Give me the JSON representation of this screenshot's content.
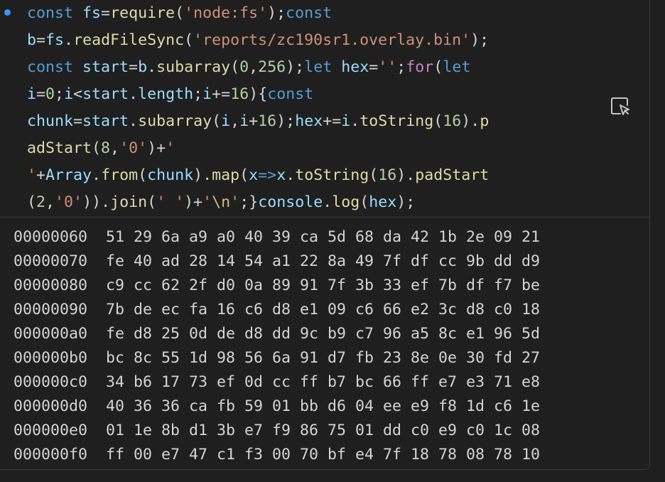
{
  "code": {
    "lines": [
      [
        {
          "t": "const",
          "c": "tk-keyword"
        },
        {
          "t": " ",
          "c": "tk-plain"
        },
        {
          "t": "fs",
          "c": "tk-var"
        },
        {
          "t": "=",
          "c": "tk-plain"
        },
        {
          "t": "require",
          "c": "tk-func"
        },
        {
          "t": "(",
          "c": "tk-plain"
        },
        {
          "t": "'node:fs'",
          "c": "tk-string"
        },
        {
          "t": ");",
          "c": "tk-plain"
        },
        {
          "t": "const",
          "c": "tk-keyword"
        }
      ],
      [
        {
          "t": "b",
          "c": "tk-var"
        },
        {
          "t": "=",
          "c": "tk-plain"
        },
        {
          "t": "fs",
          "c": "tk-var"
        },
        {
          "t": ".",
          "c": "tk-plain"
        },
        {
          "t": "readFileSync",
          "c": "tk-func"
        },
        {
          "t": "(",
          "c": "tk-plain"
        },
        {
          "t": "'reports/zc190sr1.overlay.bin'",
          "c": "tk-string"
        },
        {
          "t": ");",
          "c": "tk-plain"
        }
      ],
      [
        {
          "t": "const",
          "c": "tk-keyword"
        },
        {
          "t": " ",
          "c": "tk-plain"
        },
        {
          "t": "start",
          "c": "tk-var"
        },
        {
          "t": "=",
          "c": "tk-plain"
        },
        {
          "t": "b",
          "c": "tk-var"
        },
        {
          "t": ".",
          "c": "tk-plain"
        },
        {
          "t": "subarray",
          "c": "tk-func"
        },
        {
          "t": "(",
          "c": "tk-plain"
        },
        {
          "t": "0",
          "c": "tk-number"
        },
        {
          "t": ",",
          "c": "tk-plain"
        },
        {
          "t": "256",
          "c": "tk-number"
        },
        {
          "t": ");",
          "c": "tk-plain"
        },
        {
          "t": "let",
          "c": "tk-keyword"
        },
        {
          "t": " ",
          "c": "tk-plain"
        },
        {
          "t": "hex",
          "c": "tk-var"
        },
        {
          "t": "=",
          "c": "tk-plain"
        },
        {
          "t": "''",
          "c": "tk-string"
        },
        {
          "t": ";",
          "c": "tk-plain"
        },
        {
          "t": "for",
          "c": "tk-control"
        },
        {
          "t": "(",
          "c": "tk-plain"
        },
        {
          "t": "let",
          "c": "tk-keyword"
        }
      ],
      [
        {
          "t": "i",
          "c": "tk-var"
        },
        {
          "t": "=",
          "c": "tk-plain"
        },
        {
          "t": "0",
          "c": "tk-number"
        },
        {
          "t": ";",
          "c": "tk-plain"
        },
        {
          "t": "i",
          "c": "tk-var"
        },
        {
          "t": "<",
          "c": "tk-plain"
        },
        {
          "t": "start",
          "c": "tk-var"
        },
        {
          "t": ".",
          "c": "tk-plain"
        },
        {
          "t": "length",
          "c": "tk-var"
        },
        {
          "t": ";",
          "c": "tk-plain"
        },
        {
          "t": "i",
          "c": "tk-var"
        },
        {
          "t": "+=",
          "c": "tk-plain"
        },
        {
          "t": "16",
          "c": "tk-number"
        },
        {
          "t": "){",
          "c": "tk-plain"
        },
        {
          "t": "const",
          "c": "tk-keyword"
        }
      ],
      [
        {
          "t": "chunk",
          "c": "tk-var"
        },
        {
          "t": "=",
          "c": "tk-plain"
        },
        {
          "t": "start",
          "c": "tk-var"
        },
        {
          "t": ".",
          "c": "tk-plain"
        },
        {
          "t": "subarray",
          "c": "tk-func"
        },
        {
          "t": "(",
          "c": "tk-plain"
        },
        {
          "t": "i",
          "c": "tk-var"
        },
        {
          "t": ",",
          "c": "tk-plain"
        },
        {
          "t": "i",
          "c": "tk-var"
        },
        {
          "t": "+",
          "c": "tk-plain"
        },
        {
          "t": "16",
          "c": "tk-number"
        },
        {
          "t": ");",
          "c": "tk-plain"
        },
        {
          "t": "hex",
          "c": "tk-var"
        },
        {
          "t": "+=",
          "c": "tk-plain"
        },
        {
          "t": "i",
          "c": "tk-var"
        },
        {
          "t": ".",
          "c": "tk-plain"
        },
        {
          "t": "toString",
          "c": "tk-func"
        },
        {
          "t": "(",
          "c": "tk-plain"
        },
        {
          "t": "16",
          "c": "tk-number"
        },
        {
          "t": ").",
          "c": "tk-plain"
        },
        {
          "t": "p",
          "c": "tk-func"
        }
      ],
      [
        {
          "t": "adStart",
          "c": "tk-func"
        },
        {
          "t": "(",
          "c": "tk-plain"
        },
        {
          "t": "8",
          "c": "tk-number"
        },
        {
          "t": ",",
          "c": "tk-plain"
        },
        {
          "t": "'0'",
          "c": "tk-string"
        },
        {
          "t": ")+",
          "c": "tk-plain"
        },
        {
          "t": "'",
          "c": "tk-string"
        }
      ],
      [
        {
          "t": "'",
          "c": "tk-string"
        },
        {
          "t": "+",
          "c": "tk-plain"
        },
        {
          "t": "Array",
          "c": "tk-var"
        },
        {
          "t": ".",
          "c": "tk-plain"
        },
        {
          "t": "from",
          "c": "tk-func"
        },
        {
          "t": "(",
          "c": "tk-plain"
        },
        {
          "t": "chunk",
          "c": "tk-var"
        },
        {
          "t": ").",
          "c": "tk-plain"
        },
        {
          "t": "map",
          "c": "tk-func"
        },
        {
          "t": "(",
          "c": "tk-plain"
        },
        {
          "t": "x",
          "c": "tk-var"
        },
        {
          "t": "=>",
          "c": "tk-keyword"
        },
        {
          "t": "x",
          "c": "tk-var"
        },
        {
          "t": ".",
          "c": "tk-plain"
        },
        {
          "t": "toString",
          "c": "tk-func"
        },
        {
          "t": "(",
          "c": "tk-plain"
        },
        {
          "t": "16",
          "c": "tk-number"
        },
        {
          "t": ").",
          "c": "tk-plain"
        },
        {
          "t": "padStart",
          "c": "tk-func"
        }
      ],
      [
        {
          "t": "(",
          "c": "tk-plain"
        },
        {
          "t": "2",
          "c": "tk-number"
        },
        {
          "t": ",",
          "c": "tk-plain"
        },
        {
          "t": "'0'",
          "c": "tk-string"
        },
        {
          "t": ")).",
          "c": "tk-plain"
        },
        {
          "t": "join",
          "c": "tk-func"
        },
        {
          "t": "(",
          "c": "tk-plain"
        },
        {
          "t": "' '",
          "c": "tk-string"
        },
        {
          "t": ")+",
          "c": "tk-plain"
        },
        {
          "t": "'",
          "c": "tk-string"
        },
        {
          "t": "\\n",
          "c": "tk-escape"
        },
        {
          "t": "'",
          "c": "tk-string"
        },
        {
          "t": ";}",
          "c": "tk-plain"
        },
        {
          "t": "console",
          "c": "tk-var"
        },
        {
          "t": ".",
          "c": "tk-plain"
        },
        {
          "t": "log",
          "c": "tk-func"
        },
        {
          "t": "(",
          "c": "tk-plain"
        },
        {
          "t": "hex",
          "c": "tk-var"
        },
        {
          "t": ");",
          "c": "tk-plain"
        }
      ]
    ]
  },
  "copy_button": {
    "icon": "copy-to-terminal-icon"
  },
  "output": {
    "rows": [
      "00000060  51 29 6a a9 a0 40 39 ca 5d 68 da 42 1b 2e 09 21",
      "00000070  fe 40 ad 28 14 54 a1 22 8a 49 7f df cc 9b dd d9",
      "00000080  c9 cc 62 2f d0 0a 89 91 7f 3b 33 ef 7b df f7 be",
      "00000090  7b de ec fa 16 c6 d8 e1 09 c6 66 e2 3c d8 c0 18",
      "000000a0  fe d8 25 0d de d8 dd 9c b9 c7 96 a5 8c e1 96 5d",
      "000000b0  bc 8c 55 1d 98 56 6a 91 d7 fb 23 8e 0e 30 fd 27",
      "000000c0  34 b6 17 73 ef 0d cc ff b7 bc 66 ff e7 e3 71 e8",
      "000000d0  40 36 36 ca fb 59 01 bb d6 04 ee e9 f8 1d c6 1e",
      "000000e0  01 1e 8b d1 3b e7 f9 86 75 01 dd c0 e9 c0 1c 08",
      "000000f0  ff 00 e7 47 c1 f3 00 70 bf e4 7f 18 78 08 78 10"
    ]
  },
  "colors": {
    "background": "#1f1f1f",
    "keyword": "#569cd6",
    "control": "#c586c0",
    "variable": "#9cdcfe",
    "function": "#dcdcaa",
    "string": "#ce9178",
    "number": "#b5cea8",
    "text": "#d4d4d4",
    "status_dot": "#3794ff"
  }
}
